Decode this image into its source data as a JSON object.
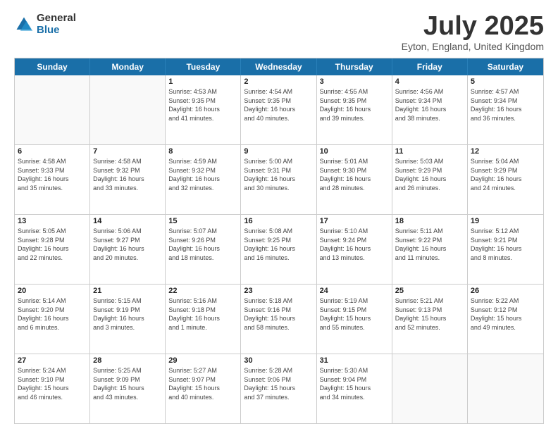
{
  "logo": {
    "general": "General",
    "blue": "Blue"
  },
  "title": "July 2025",
  "location": "Eyton, England, United Kingdom",
  "days": [
    "Sunday",
    "Monday",
    "Tuesday",
    "Wednesday",
    "Thursday",
    "Friday",
    "Saturday"
  ],
  "rows": [
    [
      {
        "day": "",
        "lines": []
      },
      {
        "day": "",
        "lines": []
      },
      {
        "day": "1",
        "lines": [
          "Sunrise: 4:53 AM",
          "Sunset: 9:35 PM",
          "Daylight: 16 hours",
          "and 41 minutes."
        ]
      },
      {
        "day": "2",
        "lines": [
          "Sunrise: 4:54 AM",
          "Sunset: 9:35 PM",
          "Daylight: 16 hours",
          "and 40 minutes."
        ]
      },
      {
        "day": "3",
        "lines": [
          "Sunrise: 4:55 AM",
          "Sunset: 9:35 PM",
          "Daylight: 16 hours",
          "and 39 minutes."
        ]
      },
      {
        "day": "4",
        "lines": [
          "Sunrise: 4:56 AM",
          "Sunset: 9:34 PM",
          "Daylight: 16 hours",
          "and 38 minutes."
        ]
      },
      {
        "day": "5",
        "lines": [
          "Sunrise: 4:57 AM",
          "Sunset: 9:34 PM",
          "Daylight: 16 hours",
          "and 36 minutes."
        ]
      }
    ],
    [
      {
        "day": "6",
        "lines": [
          "Sunrise: 4:58 AM",
          "Sunset: 9:33 PM",
          "Daylight: 16 hours",
          "and 35 minutes."
        ]
      },
      {
        "day": "7",
        "lines": [
          "Sunrise: 4:58 AM",
          "Sunset: 9:32 PM",
          "Daylight: 16 hours",
          "and 33 minutes."
        ]
      },
      {
        "day": "8",
        "lines": [
          "Sunrise: 4:59 AM",
          "Sunset: 9:32 PM",
          "Daylight: 16 hours",
          "and 32 minutes."
        ]
      },
      {
        "day": "9",
        "lines": [
          "Sunrise: 5:00 AM",
          "Sunset: 9:31 PM",
          "Daylight: 16 hours",
          "and 30 minutes."
        ]
      },
      {
        "day": "10",
        "lines": [
          "Sunrise: 5:01 AM",
          "Sunset: 9:30 PM",
          "Daylight: 16 hours",
          "and 28 minutes."
        ]
      },
      {
        "day": "11",
        "lines": [
          "Sunrise: 5:03 AM",
          "Sunset: 9:29 PM",
          "Daylight: 16 hours",
          "and 26 minutes."
        ]
      },
      {
        "day": "12",
        "lines": [
          "Sunrise: 5:04 AM",
          "Sunset: 9:29 PM",
          "Daylight: 16 hours",
          "and 24 minutes."
        ]
      }
    ],
    [
      {
        "day": "13",
        "lines": [
          "Sunrise: 5:05 AM",
          "Sunset: 9:28 PM",
          "Daylight: 16 hours",
          "and 22 minutes."
        ]
      },
      {
        "day": "14",
        "lines": [
          "Sunrise: 5:06 AM",
          "Sunset: 9:27 PM",
          "Daylight: 16 hours",
          "and 20 minutes."
        ]
      },
      {
        "day": "15",
        "lines": [
          "Sunrise: 5:07 AM",
          "Sunset: 9:26 PM",
          "Daylight: 16 hours",
          "and 18 minutes."
        ]
      },
      {
        "day": "16",
        "lines": [
          "Sunrise: 5:08 AM",
          "Sunset: 9:25 PM",
          "Daylight: 16 hours",
          "and 16 minutes."
        ]
      },
      {
        "day": "17",
        "lines": [
          "Sunrise: 5:10 AM",
          "Sunset: 9:24 PM",
          "Daylight: 16 hours",
          "and 13 minutes."
        ]
      },
      {
        "day": "18",
        "lines": [
          "Sunrise: 5:11 AM",
          "Sunset: 9:22 PM",
          "Daylight: 16 hours",
          "and 11 minutes."
        ]
      },
      {
        "day": "19",
        "lines": [
          "Sunrise: 5:12 AM",
          "Sunset: 9:21 PM",
          "Daylight: 16 hours",
          "and 8 minutes."
        ]
      }
    ],
    [
      {
        "day": "20",
        "lines": [
          "Sunrise: 5:14 AM",
          "Sunset: 9:20 PM",
          "Daylight: 16 hours",
          "and 6 minutes."
        ]
      },
      {
        "day": "21",
        "lines": [
          "Sunrise: 5:15 AM",
          "Sunset: 9:19 PM",
          "Daylight: 16 hours",
          "and 3 minutes."
        ]
      },
      {
        "day": "22",
        "lines": [
          "Sunrise: 5:16 AM",
          "Sunset: 9:18 PM",
          "Daylight: 16 hours",
          "and 1 minute."
        ]
      },
      {
        "day": "23",
        "lines": [
          "Sunrise: 5:18 AM",
          "Sunset: 9:16 PM",
          "Daylight: 15 hours",
          "and 58 minutes."
        ]
      },
      {
        "day": "24",
        "lines": [
          "Sunrise: 5:19 AM",
          "Sunset: 9:15 PM",
          "Daylight: 15 hours",
          "and 55 minutes."
        ]
      },
      {
        "day": "25",
        "lines": [
          "Sunrise: 5:21 AM",
          "Sunset: 9:13 PM",
          "Daylight: 15 hours",
          "and 52 minutes."
        ]
      },
      {
        "day": "26",
        "lines": [
          "Sunrise: 5:22 AM",
          "Sunset: 9:12 PM",
          "Daylight: 15 hours",
          "and 49 minutes."
        ]
      }
    ],
    [
      {
        "day": "27",
        "lines": [
          "Sunrise: 5:24 AM",
          "Sunset: 9:10 PM",
          "Daylight: 15 hours",
          "and 46 minutes."
        ]
      },
      {
        "day": "28",
        "lines": [
          "Sunrise: 5:25 AM",
          "Sunset: 9:09 PM",
          "Daylight: 15 hours",
          "and 43 minutes."
        ]
      },
      {
        "day": "29",
        "lines": [
          "Sunrise: 5:27 AM",
          "Sunset: 9:07 PM",
          "Daylight: 15 hours",
          "and 40 minutes."
        ]
      },
      {
        "day": "30",
        "lines": [
          "Sunrise: 5:28 AM",
          "Sunset: 9:06 PM",
          "Daylight: 15 hours",
          "and 37 minutes."
        ]
      },
      {
        "day": "31",
        "lines": [
          "Sunrise: 5:30 AM",
          "Sunset: 9:04 PM",
          "Daylight: 15 hours",
          "and 34 minutes."
        ]
      },
      {
        "day": "",
        "lines": []
      },
      {
        "day": "",
        "lines": []
      }
    ]
  ]
}
